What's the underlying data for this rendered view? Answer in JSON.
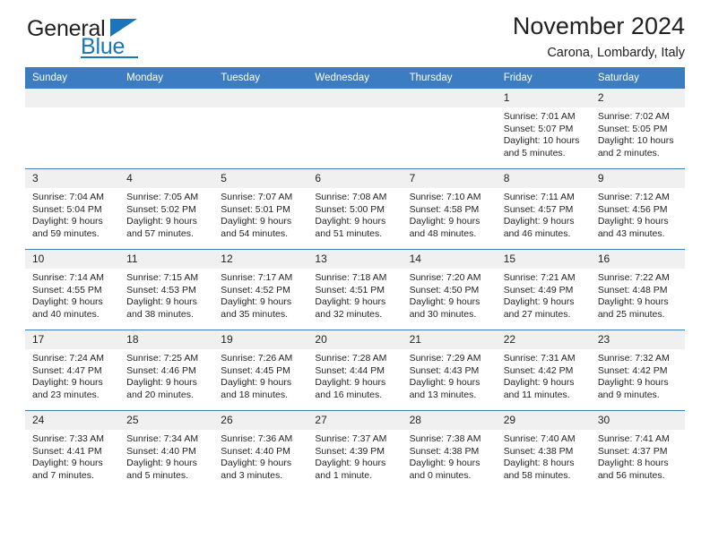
{
  "brand": {
    "name_dark": "General",
    "name_blue": "Blue",
    "accent_color": "#1b75bb"
  },
  "header": {
    "title": "November 2024",
    "subtitle": "Carona, Lombardy, Italy"
  },
  "calendar": {
    "header_bg": "#3b7dc0",
    "daynum_bg": "#f0f0f0",
    "weekday_headers": [
      "Sunday",
      "Monday",
      "Tuesday",
      "Wednesday",
      "Thursday",
      "Friday",
      "Saturday"
    ],
    "weeks": [
      [
        {
          "day": "",
          "lines": []
        },
        {
          "day": "",
          "lines": []
        },
        {
          "day": "",
          "lines": []
        },
        {
          "day": "",
          "lines": []
        },
        {
          "day": "",
          "lines": []
        },
        {
          "day": "1",
          "lines": [
            "Sunrise: 7:01 AM",
            "Sunset: 5:07 PM",
            "Daylight: 10 hours",
            "and 5 minutes."
          ]
        },
        {
          "day": "2",
          "lines": [
            "Sunrise: 7:02 AM",
            "Sunset: 5:05 PM",
            "Daylight: 10 hours",
            "and 2 minutes."
          ]
        }
      ],
      [
        {
          "day": "3",
          "lines": [
            "Sunrise: 7:04 AM",
            "Sunset: 5:04 PM",
            "Daylight: 9 hours",
            "and 59 minutes."
          ]
        },
        {
          "day": "4",
          "lines": [
            "Sunrise: 7:05 AM",
            "Sunset: 5:02 PM",
            "Daylight: 9 hours",
            "and 57 minutes."
          ]
        },
        {
          "day": "5",
          "lines": [
            "Sunrise: 7:07 AM",
            "Sunset: 5:01 PM",
            "Daylight: 9 hours",
            "and 54 minutes."
          ]
        },
        {
          "day": "6",
          "lines": [
            "Sunrise: 7:08 AM",
            "Sunset: 5:00 PM",
            "Daylight: 9 hours",
            "and 51 minutes."
          ]
        },
        {
          "day": "7",
          "lines": [
            "Sunrise: 7:10 AM",
            "Sunset: 4:58 PM",
            "Daylight: 9 hours",
            "and 48 minutes."
          ]
        },
        {
          "day": "8",
          "lines": [
            "Sunrise: 7:11 AM",
            "Sunset: 4:57 PM",
            "Daylight: 9 hours",
            "and 46 minutes."
          ]
        },
        {
          "day": "9",
          "lines": [
            "Sunrise: 7:12 AM",
            "Sunset: 4:56 PM",
            "Daylight: 9 hours",
            "and 43 minutes."
          ]
        }
      ],
      [
        {
          "day": "10",
          "lines": [
            "Sunrise: 7:14 AM",
            "Sunset: 4:55 PM",
            "Daylight: 9 hours",
            "and 40 minutes."
          ]
        },
        {
          "day": "11",
          "lines": [
            "Sunrise: 7:15 AM",
            "Sunset: 4:53 PM",
            "Daylight: 9 hours",
            "and 38 minutes."
          ]
        },
        {
          "day": "12",
          "lines": [
            "Sunrise: 7:17 AM",
            "Sunset: 4:52 PM",
            "Daylight: 9 hours",
            "and 35 minutes."
          ]
        },
        {
          "day": "13",
          "lines": [
            "Sunrise: 7:18 AM",
            "Sunset: 4:51 PM",
            "Daylight: 9 hours",
            "and 32 minutes."
          ]
        },
        {
          "day": "14",
          "lines": [
            "Sunrise: 7:20 AM",
            "Sunset: 4:50 PM",
            "Daylight: 9 hours",
            "and 30 minutes."
          ]
        },
        {
          "day": "15",
          "lines": [
            "Sunrise: 7:21 AM",
            "Sunset: 4:49 PM",
            "Daylight: 9 hours",
            "and 27 minutes."
          ]
        },
        {
          "day": "16",
          "lines": [
            "Sunrise: 7:22 AM",
            "Sunset: 4:48 PM",
            "Daylight: 9 hours",
            "and 25 minutes."
          ]
        }
      ],
      [
        {
          "day": "17",
          "lines": [
            "Sunrise: 7:24 AM",
            "Sunset: 4:47 PM",
            "Daylight: 9 hours",
            "and 23 minutes."
          ]
        },
        {
          "day": "18",
          "lines": [
            "Sunrise: 7:25 AM",
            "Sunset: 4:46 PM",
            "Daylight: 9 hours",
            "and 20 minutes."
          ]
        },
        {
          "day": "19",
          "lines": [
            "Sunrise: 7:26 AM",
            "Sunset: 4:45 PM",
            "Daylight: 9 hours",
            "and 18 minutes."
          ]
        },
        {
          "day": "20",
          "lines": [
            "Sunrise: 7:28 AM",
            "Sunset: 4:44 PM",
            "Daylight: 9 hours",
            "and 16 minutes."
          ]
        },
        {
          "day": "21",
          "lines": [
            "Sunrise: 7:29 AM",
            "Sunset: 4:43 PM",
            "Daylight: 9 hours",
            "and 13 minutes."
          ]
        },
        {
          "day": "22",
          "lines": [
            "Sunrise: 7:31 AM",
            "Sunset: 4:42 PM",
            "Daylight: 9 hours",
            "and 11 minutes."
          ]
        },
        {
          "day": "23",
          "lines": [
            "Sunrise: 7:32 AM",
            "Sunset: 4:42 PM",
            "Daylight: 9 hours",
            "and 9 minutes."
          ]
        }
      ],
      [
        {
          "day": "24",
          "lines": [
            "Sunrise: 7:33 AM",
            "Sunset: 4:41 PM",
            "Daylight: 9 hours",
            "and 7 minutes."
          ]
        },
        {
          "day": "25",
          "lines": [
            "Sunrise: 7:34 AM",
            "Sunset: 4:40 PM",
            "Daylight: 9 hours",
            "and 5 minutes."
          ]
        },
        {
          "day": "26",
          "lines": [
            "Sunrise: 7:36 AM",
            "Sunset: 4:40 PM",
            "Daylight: 9 hours",
            "and 3 minutes."
          ]
        },
        {
          "day": "27",
          "lines": [
            "Sunrise: 7:37 AM",
            "Sunset: 4:39 PM",
            "Daylight: 9 hours",
            "and 1 minute."
          ]
        },
        {
          "day": "28",
          "lines": [
            "Sunrise: 7:38 AM",
            "Sunset: 4:38 PM",
            "Daylight: 9 hours",
            "and 0 minutes."
          ]
        },
        {
          "day": "29",
          "lines": [
            "Sunrise: 7:40 AM",
            "Sunset: 4:38 PM",
            "Daylight: 8 hours",
            "and 58 minutes."
          ]
        },
        {
          "day": "30",
          "lines": [
            "Sunrise: 7:41 AM",
            "Sunset: 4:37 PM",
            "Daylight: 8 hours",
            "and 56 minutes."
          ]
        }
      ]
    ]
  }
}
